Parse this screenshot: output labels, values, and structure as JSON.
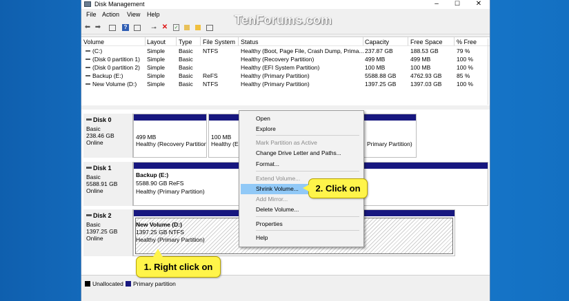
{
  "window": {
    "title": "Disk Management",
    "controls": [
      "–",
      "☐",
      "✕"
    ]
  },
  "menu": [
    "File",
    "Action",
    "View",
    "Help"
  ],
  "watermark": "TenForums.com",
  "volumes": {
    "headers": [
      "Volume",
      "Layout",
      "Type",
      "File System",
      "Status",
      "Capacity",
      "Free Space",
      "% Free"
    ],
    "rows": [
      [
        "(C:)",
        "Simple",
        "Basic",
        "NTFS",
        "Healthy (Boot, Page File, Crash Dump, Prima...",
        "237.87 GB",
        "188.53 GB",
        "79 %"
      ],
      [
        "(Disk 0 partition 1)",
        "Simple",
        "Basic",
        "",
        "Healthy (Recovery Partition)",
        "499 MB",
        "499 MB",
        "100 %"
      ],
      [
        "(Disk 0 partition 2)",
        "Simple",
        "Basic",
        "",
        "Healthy (EFI System Partition)",
        "100 MB",
        "100 MB",
        "100 %"
      ],
      [
        "Backup (E:)",
        "Simple",
        "Basic",
        "ReFS",
        "Healthy (Primary Partition)",
        "5588.88 GB",
        "4762.93 GB",
        "85 %"
      ],
      [
        "New Volume (D:)",
        "Simple",
        "Basic",
        "NTFS",
        "Healthy (Primary Partition)",
        "1397.25 GB",
        "1397.03 GB",
        "100 %"
      ]
    ]
  },
  "disks": [
    {
      "name": "Disk 0",
      "type": "Basic",
      "size": "238.46 GB",
      "state": "Online",
      "partitions": [
        {
          "l1": "",
          "l2": "499 MB",
          "l3": "Healthy (Recovery Partition"
        },
        {
          "l1": "",
          "l2": "100 MB",
          "l3": "Healthy (EF"
        },
        {
          "l1": "",
          "l2": "",
          "l3": "Primary Partition)"
        }
      ]
    },
    {
      "name": "Disk 1",
      "type": "Basic",
      "size": "5588.91 GB",
      "state": "Online",
      "partitions": [
        {
          "l1": "Backup  (E:)",
          "l2": "5588.90 GB ReFS",
          "l3": "Healthy (Primary Partition)"
        }
      ]
    },
    {
      "name": "Disk 2",
      "type": "Basic",
      "size": "1397.25 GB",
      "state": "Online",
      "partitions": [
        {
          "l1": "New Volume  (D:)",
          "l2": "1397.25 GB NTFS",
          "l3": "Healthy (Primary Partition)"
        }
      ]
    }
  ],
  "legend": [
    {
      "label": "Unallocated",
      "color": "#000000"
    },
    {
      "label": "Primary partition",
      "color": "#17177f"
    }
  ],
  "context_menu": {
    "items": [
      {
        "label": "Open",
        "enabled": true
      },
      {
        "label": "Explore",
        "enabled": true
      },
      {
        "label": "Mark Partition as Active",
        "enabled": false
      },
      {
        "label": "Change Drive Letter and Paths...",
        "enabled": true
      },
      {
        "label": "Format...",
        "enabled": true
      },
      {
        "label": "Extend Volume...",
        "enabled": false
      },
      {
        "label": "Shrink Volume...",
        "enabled": true,
        "highlighted": true
      },
      {
        "label": "Add Mirror...",
        "enabled": false
      },
      {
        "label": "Delete Volume...",
        "enabled": true
      },
      {
        "label": "Properties",
        "enabled": true
      },
      {
        "label": "Help",
        "enabled": true
      }
    ]
  },
  "callouts": {
    "step1": "1. Right click on",
    "step2": "2. Click on"
  },
  "colors": {
    "primary_partition": "#17177f",
    "highlight": "#91c9f7",
    "callout": "#fff44a",
    "desktop": "#1673c8"
  }
}
